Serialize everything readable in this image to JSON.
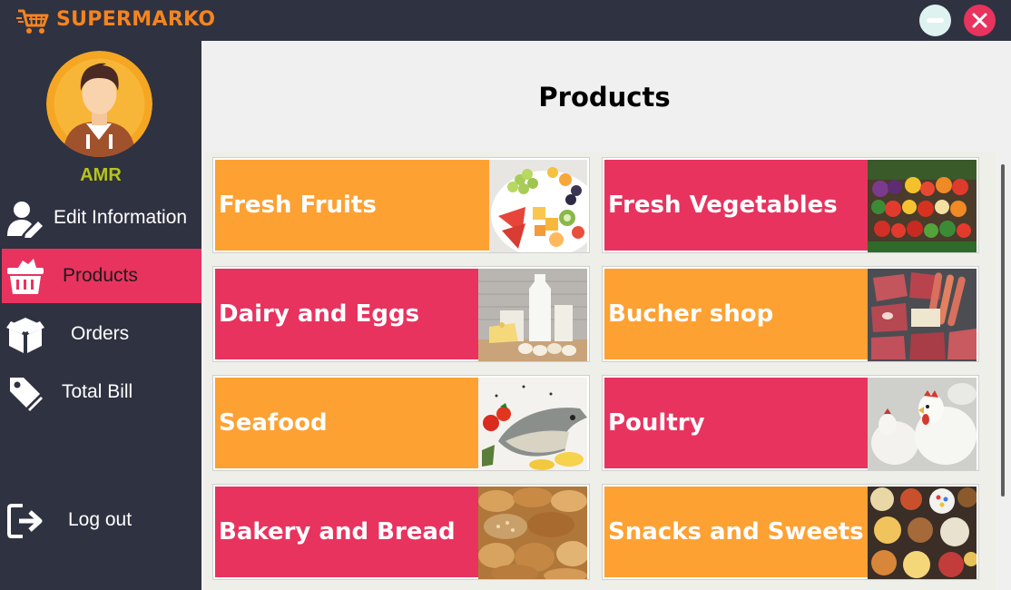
{
  "app": {
    "brand": "SUPERMARKO",
    "colors": {
      "accent_orange": "#f5841f",
      "pink": "#e8335f",
      "orange_band": "#fda133",
      "sidebar_bg": "#2f3241",
      "username": "#b7c41c"
    },
    "window_controls": {
      "minimize_icon": "minimize-icon",
      "close_icon": "close-icon"
    }
  },
  "user": {
    "name": "AMR"
  },
  "sidebar": {
    "items": [
      {
        "label": "Edit Information",
        "icon": "user-edit-icon",
        "active": false
      },
      {
        "label": "Products",
        "icon": "basket-icon",
        "active": true
      },
      {
        "label": "Orders",
        "icon": "package-box-icon",
        "active": false
      },
      {
        "label": "Total Bill",
        "icon": "price-tag-icon",
        "active": false
      }
    ],
    "logout": {
      "label": "Log out",
      "icon": "logout-icon"
    }
  },
  "main": {
    "title": "Products",
    "categories": [
      {
        "label": "Fresh Fruits",
        "color": "orange",
        "image": "fruit-platter-photo"
      },
      {
        "label": "Fresh Vegetables",
        "color": "pink",
        "image": "vegetables-stall-photo"
      },
      {
        "label": "Dairy and Eggs",
        "color": "pink",
        "image": "dairy-eggs-photo"
      },
      {
        "label": "Bucher shop",
        "color": "orange",
        "image": "meat-sausages-photo"
      },
      {
        "label": "Seafood",
        "color": "orange",
        "image": "fish-tomatoes-photo"
      },
      {
        "label": "Poultry",
        "color": "pink",
        "image": "chickens-photo"
      },
      {
        "label": "Bakery and Bread",
        "color": "pink",
        "image": "bread-loaves-photo"
      },
      {
        "label": "Snacks and Sweets",
        "color": "orange",
        "image": "snacks-bowls-photo"
      }
    ]
  }
}
